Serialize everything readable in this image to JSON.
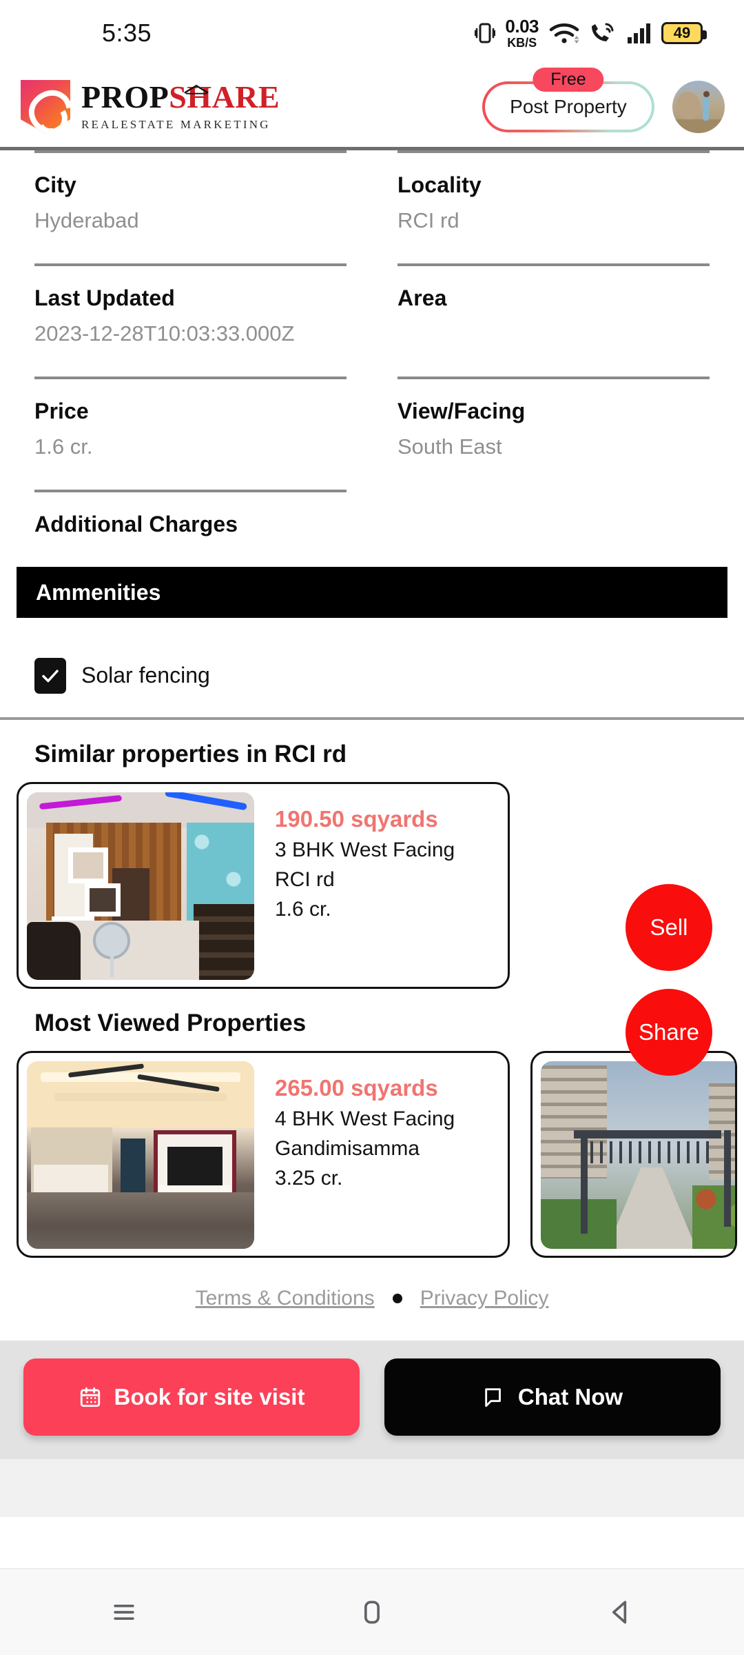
{
  "status_bar": {
    "time": "5:35",
    "net_speed_value": "0.03",
    "net_speed_unit": "KB/S",
    "battery_level": "49",
    "icons": [
      "vibrate-icon",
      "wifi-icon",
      "wifi-calling-icon",
      "signal-icon",
      "battery-icon"
    ]
  },
  "header": {
    "brand_part1": "PROP",
    "brand_part2": "SHARE",
    "brand_subtitle": "REALESTATE MARKETING",
    "post_property_label": "Post Property",
    "free_badge": "Free",
    "avatar_alt": "user-avatar"
  },
  "details": {
    "rows": [
      [
        {
          "label": "City",
          "value": "Hyderabad"
        },
        {
          "label": "Locality",
          "value": "RCI rd"
        }
      ],
      [
        {
          "label": "Last Updated",
          "value": "2023-12-28T10:03:33.000Z"
        },
        {
          "label": "Area",
          "value": ""
        }
      ],
      [
        {
          "label": "Price",
          "value": "1.6 cr."
        },
        {
          "label": "View/Facing",
          "value": "South East"
        }
      ],
      [
        {
          "label": "Additional Charges",
          "value": ""
        },
        {
          "label": "",
          "value": ""
        }
      ]
    ]
  },
  "amenities": {
    "title": "Ammenities",
    "items": [
      {
        "label": "Solar fencing",
        "checked": true
      }
    ]
  },
  "similar": {
    "title": "Similar properties in RCI rd",
    "cards": [
      {
        "area": "190.50 sqyards",
        "config": "3 BHK West Facing",
        "locality": "RCI rd",
        "price": "1.6 cr."
      }
    ]
  },
  "most_viewed": {
    "title": "Most Viewed Properties",
    "cards": [
      {
        "area": "265.00 sqyards",
        "config": "4 BHK West Facing",
        "locality": "Gandimisamma",
        "price": "3.25 cr."
      },
      {
        "area": "",
        "config": "",
        "locality": "",
        "price": ""
      }
    ]
  },
  "fabs": {
    "sell": "Sell",
    "share": "Share"
  },
  "footer": {
    "terms": "Terms & Conditions",
    "privacy": "Privacy Policy"
  },
  "bottom_actions": {
    "book_label": "Book for site visit",
    "chat_label": "Chat  Now"
  },
  "nav": {
    "recents": "recents-icon",
    "home": "home-icon",
    "back": "back-icon"
  },
  "colors": {
    "accent_red": "#fb4058",
    "card_area_red": "#f07470",
    "fab_red": "#fa0d0d",
    "brand_red": "#d12028",
    "battery_yellow": "#FFD95E"
  }
}
